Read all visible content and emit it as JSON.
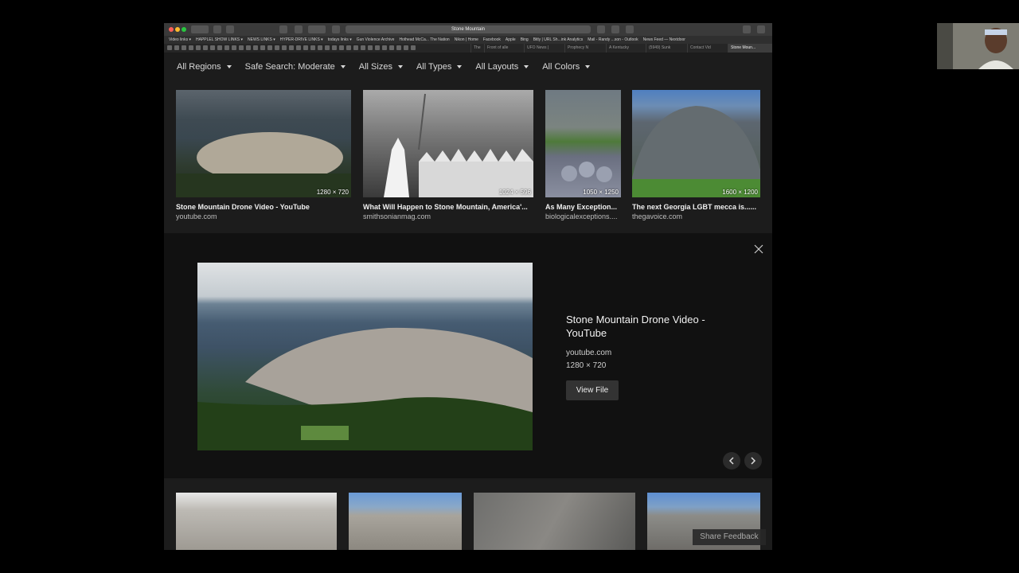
{
  "browser": {
    "address": "Stone Mountain",
    "bookmarks": [
      "Video links ▾",
      "HAPPLEL SHOW LINKS ▾",
      "NEWS LINKS ▾",
      "HYPER-DRIVE LINKS ▾",
      "todays links ▾",
      "Gun Violence Archive",
      "Hothead McCa... The Nation",
      "Nikon | Home",
      "Facebook",
      "Apple",
      "Bing",
      "Bitly | URL Sh...ink Analytics",
      "Mail - Randy ...son - Outlook",
      "News Feed — Nextdoor"
    ],
    "tabs": [
      "The",
      "Front of alle",
      "UFO News |",
      "Prophecy N",
      "A Kentucky",
      "(5949) Sunk",
      "Contact Vid",
      "Stone Moun..."
    ]
  },
  "filters": [
    "All Regions",
    "Safe Search: Moderate",
    "All Sizes",
    "All Types",
    "All Layouts",
    "All Colors"
  ],
  "results": [
    {
      "title": "Stone Mountain Drone Video - YouTube",
      "source": "youtube.com",
      "size": "1280 × 720"
    },
    {
      "title": "What Will Happen to Stone Mountain, America'...",
      "source": "smithsonianmag.com",
      "size": "1024 × 596"
    },
    {
      "title": "As Many Exception...",
      "source": "biologicalexceptions....",
      "size": "1050 × 1250"
    },
    {
      "title": "The next Georgia LGBT mecca is......",
      "source": "thegavoice.com",
      "size": "1600 × 1200"
    }
  ],
  "detail": {
    "title": "Stone Mountain Drone Video - YouTube",
    "source": "youtube.com",
    "size": "1280 × 720",
    "view_label": "View File"
  },
  "feedback_label": "Share Feedback"
}
